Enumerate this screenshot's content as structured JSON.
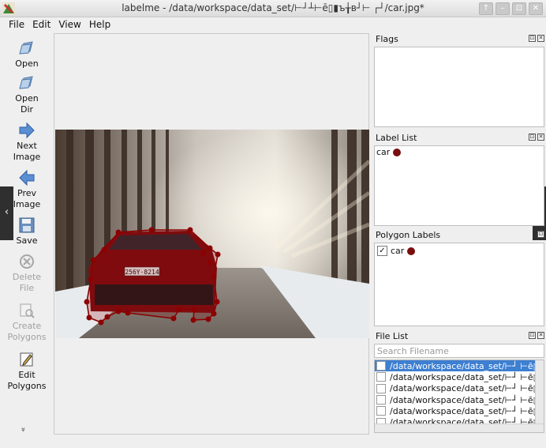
{
  "window": {
    "title": "labelme - /data/workspace/data_set/⊢┘┴⊢ē▯▮ъ╁ʙ┘⊢ ┌┘/car.jpg*",
    "buttons": [
      "↑",
      "–",
      "⊡",
      "✕"
    ]
  },
  "menu": [
    "File",
    "Edit",
    "View",
    "Help"
  ],
  "toolbar": {
    "open": "Open",
    "open_dir_1": "Open",
    "open_dir_2": "Dir",
    "next_1": "Next",
    "next_2": "Image",
    "prev_1": "Prev",
    "prev_2": "Image",
    "save": "Save",
    "delete_1": "Delete",
    "delete_2": "File",
    "create_1": "Create",
    "create_2": "Polygons",
    "edit_1": "Edit",
    "edit_2": "Polygons",
    "more": "»"
  },
  "nav": {
    "prev": "‹",
    "next": "›"
  },
  "panels": {
    "flags": {
      "title": "Flags"
    },
    "label_list": {
      "title": "Label List",
      "items": [
        {
          "label": "car",
          "color": "#7a0d0d"
        }
      ]
    },
    "polygon_labels": {
      "title": "Polygon Labels",
      "items": [
        {
          "label": "car",
          "checked": true,
          "check_glyph": "✓",
          "color": "#7a0d0d"
        }
      ]
    },
    "file_list": {
      "title": "File List",
      "search_placeholder": "Search Filename",
      "files": [
        "/data/workspace/data_set/⊢┘ ⊢ē▯",
        "/data/workspace/data_set/⊢┘ ⊢ē▯",
        "/data/workspace/data_set/⊢┘ ⊢ē▯",
        "/data/workspace/data_set/⊢┘ ⊢ē▯",
        "/data/workspace/data_set/⊢┘ ⊢ē▯",
        "/data/workspace/data_set/⊢┘ ⊢ē▯"
      ]
    }
  },
  "canvas": {
    "plate_text": "256Y·8214"
  },
  "colors": {
    "selection": "#3d7fd1",
    "polygon": "#8b0000",
    "label_dot": "#7a0d0d"
  }
}
